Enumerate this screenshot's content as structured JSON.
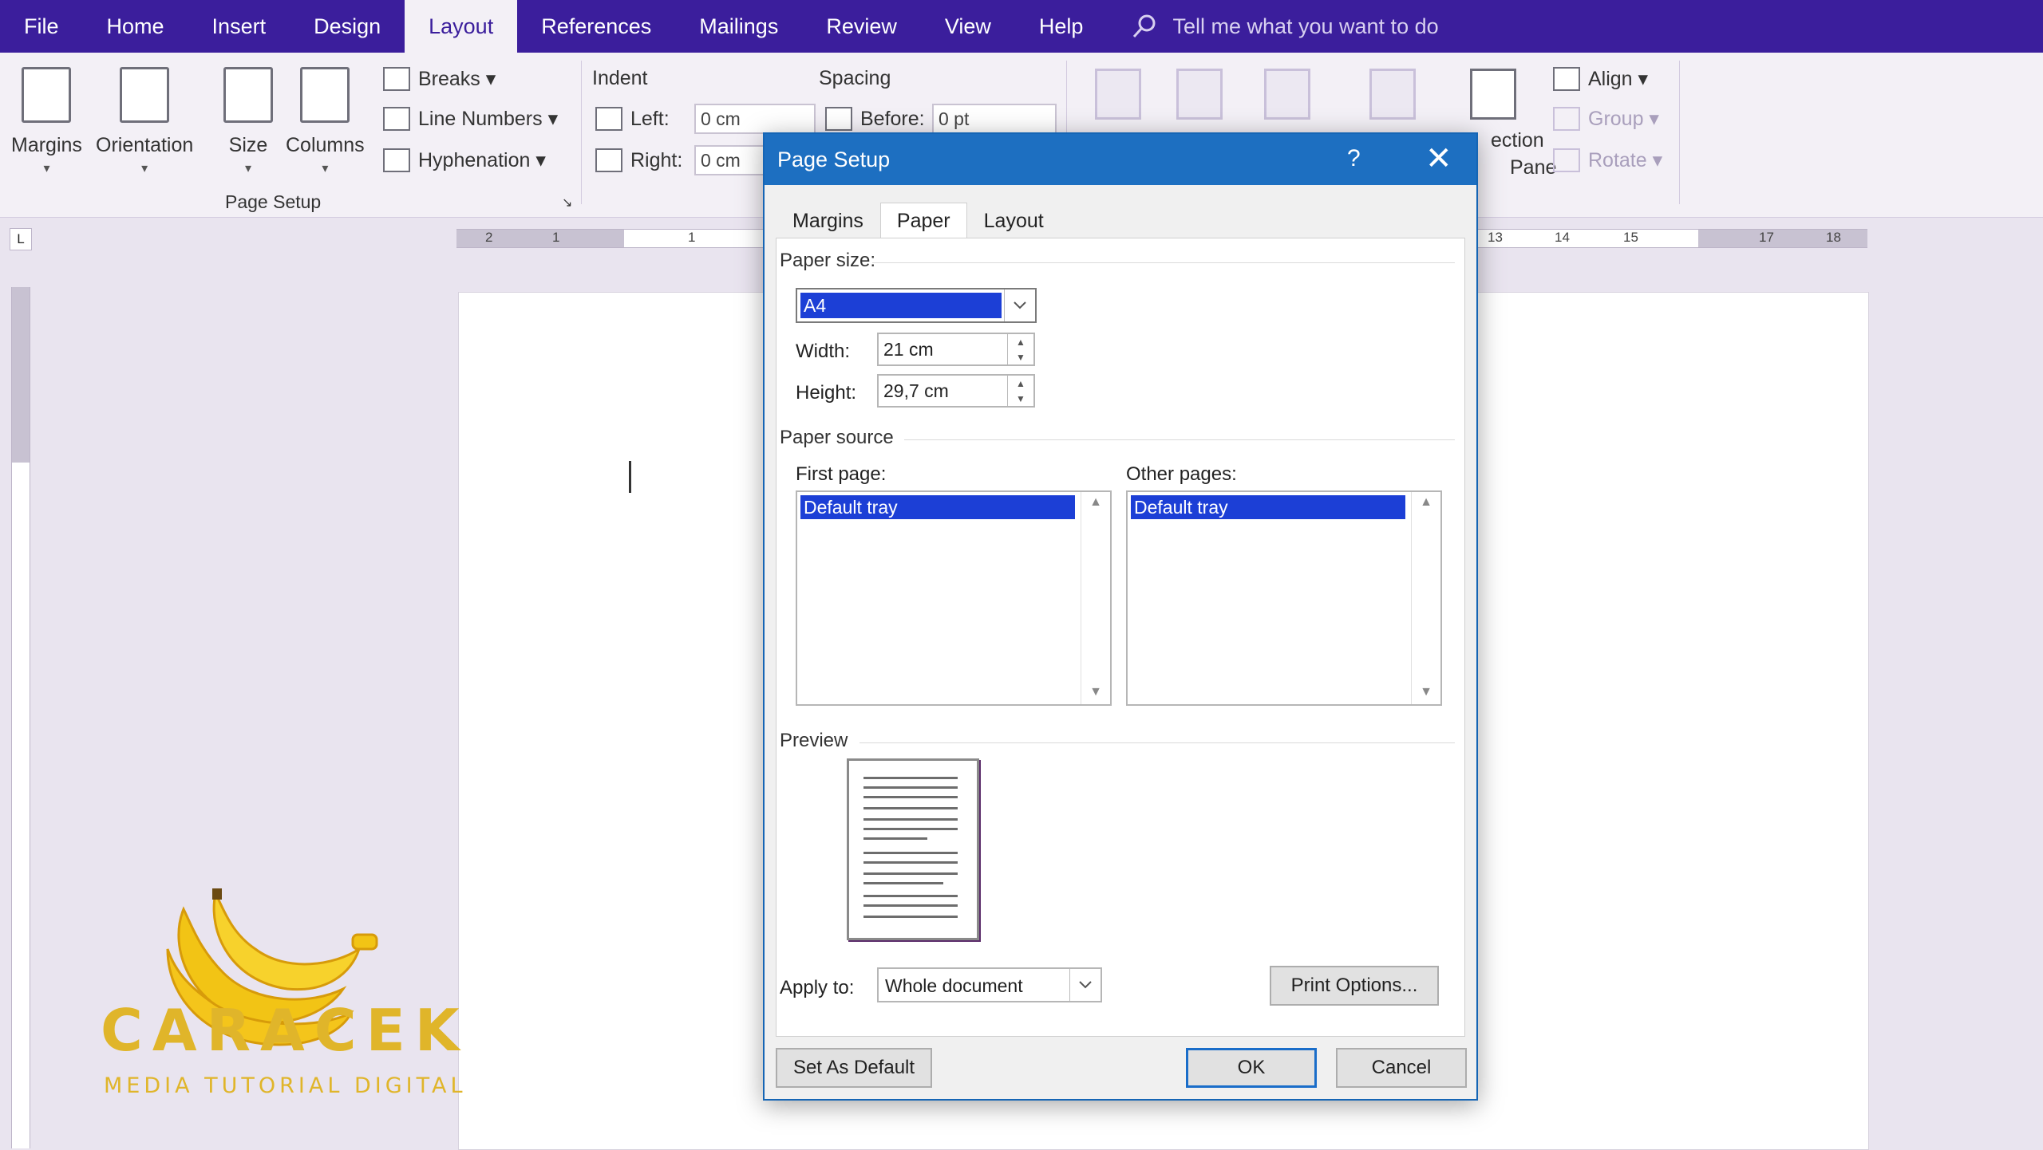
{
  "menu": {
    "items": [
      "File",
      "Home",
      "Insert",
      "Design",
      "Layout",
      "References",
      "Mailings",
      "Review",
      "View",
      "Help"
    ],
    "active": "Layout",
    "tell_me": "Tell me what you want to do"
  },
  "ribbon": {
    "margins": "Margins",
    "orientation": "Orientation",
    "size": "Size",
    "columns": "Columns",
    "breaks": "Breaks",
    "line_numbers": "Line Numbers",
    "hyphenation": "Hyphenation",
    "page_setup_group": "Page Setup",
    "indent_heading": "Indent",
    "indent_left_label": "Left:",
    "indent_left_value": "0 cm",
    "indent_right_label": "Right:",
    "indent_right_value": "0 cm",
    "spacing_heading": "Spacing",
    "spacing_before_label": "Before:",
    "spacing_before_value": "0 pt",
    "selection_pane_partial_1": "ection",
    "selection_pane_partial_2": "Pane",
    "align": "Align",
    "group": "Group",
    "rotate": "Rotate"
  },
  "ruler": {
    "ticks_left": [
      "2",
      "1",
      "1"
    ],
    "ticks_right": [
      "13",
      "14",
      "15",
      "17",
      "18"
    ]
  },
  "dialog": {
    "title": "Page Setup",
    "help": "?",
    "close": "✕",
    "tabs": [
      "Margins",
      "Paper",
      "Layout"
    ],
    "active_tab": "Paper",
    "paper_size_label": "Paper size:",
    "paper_size_value": "A4",
    "width_label": "Width:",
    "width_value": "21 cm",
    "height_label": "Height:",
    "height_value": "29,7 cm",
    "paper_source_label": "Paper source",
    "first_page_label": "First page:",
    "first_page_selected": "Default tray",
    "other_pages_label": "Other pages:",
    "other_pages_selected": "Default tray",
    "preview_label": "Preview",
    "apply_to_label": "Apply to:",
    "apply_to_value": "Whole document",
    "print_options": "Print Options...",
    "set_as_default": "Set As Default",
    "ok": "OK",
    "cancel": "Cancel"
  },
  "watermark": {
    "title": "CARACEK",
    "subtitle": "MEDIA TUTORIAL DIGITAL"
  }
}
